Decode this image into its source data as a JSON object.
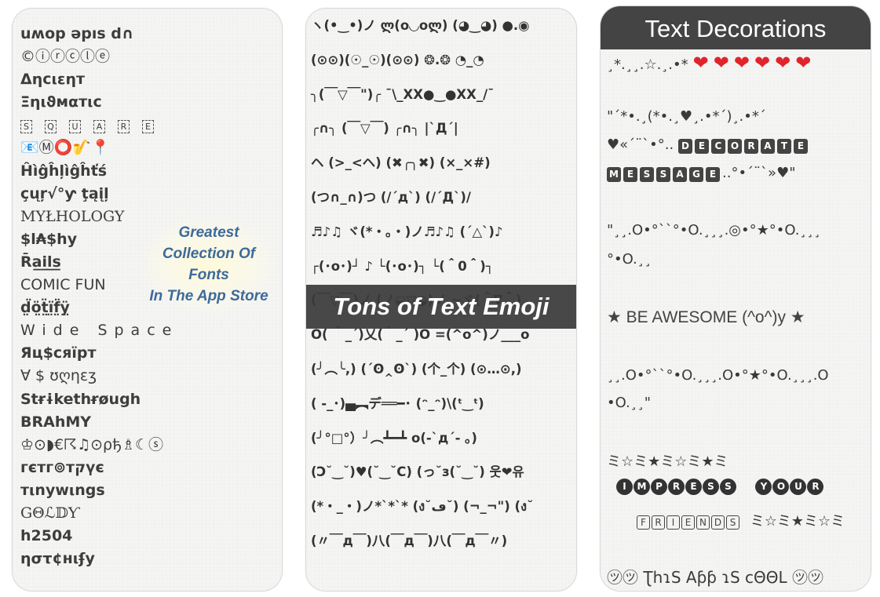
{
  "panel_fonts": {
    "fonts": [
      "uʍop ǝpıs d∩",
      "©ⓘⓡⓒⓛⓔ",
      "Δηcιεηт",
      "Ξηιϑмαтιc",
      "",
      "📧Ⓜ⭕🎷📍",
      "Ĥìĝĥļìĝĥťś",
      "çųŗ√°ƴ ţąįļ",
      "MYŁHOLOGY",
      "$l₳$hy",
      "R̄a̲i̲l̲s̲",
      "COMIC FUN",
      "d̤̈ö̤ẗ̤ï̤f̤̈ÿ̤",
      "Wide Space",
      "Яц$cяïpт",
      "∀ $ ʊღηɛʒ",
      "Stɍɨkethɍøugh",
      "BRAhMY",
      "♔⊙◗€☈♫⊙ρђ♗☾ⓢ",
      "гєтг⊚тקүє",
      "тιnywιngs",
      "GΘℒ𝔻Ƴ",
      "h2504",
      "ηστ¢нιʄу"
    ],
    "square_letters": [
      "S",
      "Q",
      "U",
      "A",
      "R",
      "E"
    ],
    "promo_lines": [
      "Greatest",
      "Collection Of",
      "Fonts",
      "In The App Store"
    ]
  },
  "panel_emoji": {
    "rows": [
      "ヽ(•‿•)ノ  ლ(o◡oლ)  (◕‿◕)  ●.◉",
      "(⊙⊙)(☉_☉)(⊙⊙)   ❂.❂   ◔_◔",
      "╮(￣▽￣\")╭   ¯\\_XX●‿●XX_/¯",
      "╭∩╮  (￣▽￣)  ╭∩╮    |`Д´|",
      "ヘ (>_<ヘ)  (✖╭╮✖)   (×_×#)",
      "(つ∩_∩)つ    (/´д`)     (/´Д`)/",
      "♬♪♫ ヾ(*・。・)ノ♬♪♫  (´△`)♪",
      "┌(･o･)┘ ♪ └(･o･)┐   └(＾0＾)┐",
      "(￣▽￣)ノ  (ノ◒▽◒)ノ  ~ヾ(＾∇＾)",
      "O( ｀_´)乂(｀_´ )O  =(^o^)ノ___o",
      "(╯︵╰,)  (´ʘ‸ʘ`)  (个_个)  (⊙…⊙,)",
      "(  -_･)▄︻デ══━･   (ᵔ_ᵔ)\\(ᵗ‿ᵗ)",
      "(╯°□°）╯︵┻━┻     o(-`д´- ｡)",
      "(Ͻ˘‿˘)♥(˘‿˘C)  (っ˘з(˘‿˘)  웃❤유",
      "(*・_・)ノ*`*`*  (ง˘ڡ˘)  (¬_¬\")  (ง˘",
      "(〃￣д￣)八(￣д￣)八(￣д￣〃)"
    ],
    "banner": "Tons of Text Emoji"
  },
  "panel_deco": {
    "header": "Text Decorations",
    "row1_prefix": "¸*.¸¸.☆.¸.•*",
    "hearts": [
      "❤",
      "❤",
      "❤",
      "❤",
      "❤",
      "❤"
    ],
    "row2": "\"´*•.¸(*•.¸♥¸.•*´)¸.•*´",
    "row3_prefix": "♥«´¨`•°..",
    "decorate": [
      "D",
      "E",
      "C",
      "O",
      "R",
      "A",
      "T",
      "E"
    ],
    "message": [
      "M",
      "E",
      "S",
      "S",
      "A",
      "G",
      "E"
    ],
    "row4_suffix": "..°•´¨`»♥\"",
    "wave1a": "\"¸¸.O•°``°•O.¸¸¸.◎•°★°•O.¸¸¸",
    "wave1b": "°•O.¸¸",
    "awesome": "★ BE AWESOME (^o^)y ★",
    "wave2a": "¸¸.O•°``°•O.¸¸¸.O•°★°•O.¸¸¸.O",
    "wave2b": "•O.¸¸\"",
    "stars": "ミ☆ミ★ミ☆ミ★ミ",
    "impress": [
      "I",
      "M",
      "P",
      "R",
      "E",
      "S",
      "S"
    ],
    "your": [
      "Y",
      "O",
      "U",
      "R"
    ],
    "friends": [
      "F",
      "R",
      "I",
      "E",
      "N",
      "D",
      "S"
    ],
    "stars2": "ミ☆ミ★ミ☆ミ",
    "cool": "㋡㋡ ƮhɿS Aƥƥ ɿS cΘΘL ㋡㋡"
  }
}
